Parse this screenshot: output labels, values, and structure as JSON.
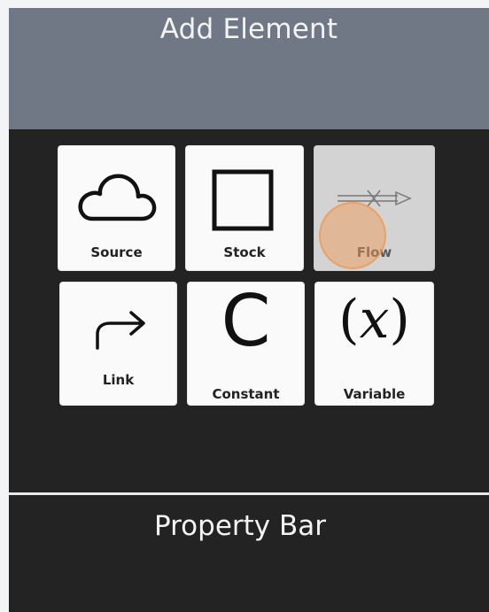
{
  "header": {
    "title": "Add Element"
  },
  "elements": [
    {
      "label": "Source",
      "icon": "cloud-icon"
    },
    {
      "label": "Stock",
      "icon": "square-icon"
    },
    {
      "label": "Flow",
      "icon": "flow-arrow-icon",
      "selected": true
    },
    {
      "label": "Link",
      "icon": "link-arrow-icon"
    },
    {
      "label": "Constant",
      "icon": "constant-c-icon",
      "glyph": "C"
    },
    {
      "label": "Variable",
      "icon": "variable-x-icon",
      "glyph_open": "(",
      "glyph_var": "x",
      "glyph_close": ")"
    }
  ],
  "property_bar": {
    "title": "Property Bar"
  },
  "colors": {
    "header_bg": "#6f7884",
    "app_bg": "#232323",
    "tile_bg": "#fafafa",
    "tile_selected_bg": "#d3d3d3",
    "cursor_highlight": "#f0a060"
  }
}
